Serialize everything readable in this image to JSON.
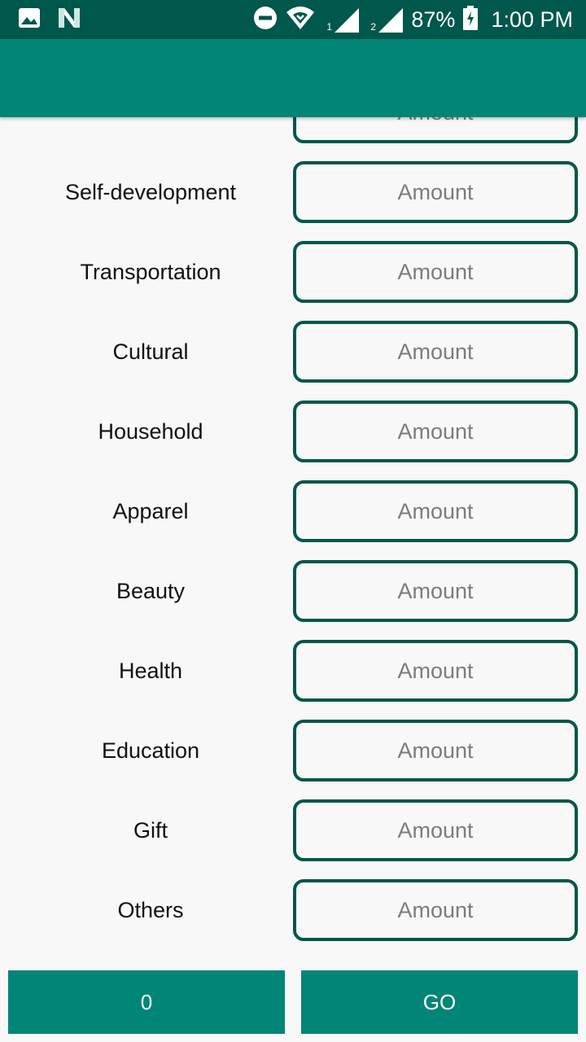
{
  "status_bar": {
    "icons": [
      "image-icon",
      "n-app-icon",
      "do-not-disturb-icon",
      "wifi-icon",
      "signal-sim1-icon",
      "signal-sim2-icon",
      "battery-charging-icon"
    ],
    "sim1": "1",
    "sim2": "2",
    "battery": "87%",
    "time": "1:00 PM"
  },
  "app_bar": {
    "title": ""
  },
  "categories": [
    {
      "label": "",
      "placeholder": "Amount",
      "value": ""
    },
    {
      "label": "Self-development",
      "placeholder": "Amount",
      "value": ""
    },
    {
      "label": "Transportation",
      "placeholder": "Amount",
      "value": ""
    },
    {
      "label": "Cultural",
      "placeholder": "Amount",
      "value": ""
    },
    {
      "label": "Household",
      "placeholder": "Amount",
      "value": ""
    },
    {
      "label": "Apparel",
      "placeholder": "Amount",
      "value": ""
    },
    {
      "label": "Beauty",
      "placeholder": "Amount",
      "value": ""
    },
    {
      "label": "Health",
      "placeholder": "Amount",
      "value": ""
    },
    {
      "label": "Education",
      "placeholder": "Amount",
      "value": ""
    },
    {
      "label": "Gift",
      "placeholder": "Amount",
      "value": ""
    },
    {
      "label": "Others",
      "placeholder": "Amount",
      "value": ""
    }
  ],
  "buttons": {
    "total": "0",
    "go": "GO"
  },
  "colors": {
    "status_bar": "#00574b",
    "primary": "#008577",
    "field_border": "#00574b",
    "background": "#f8f8f8"
  }
}
